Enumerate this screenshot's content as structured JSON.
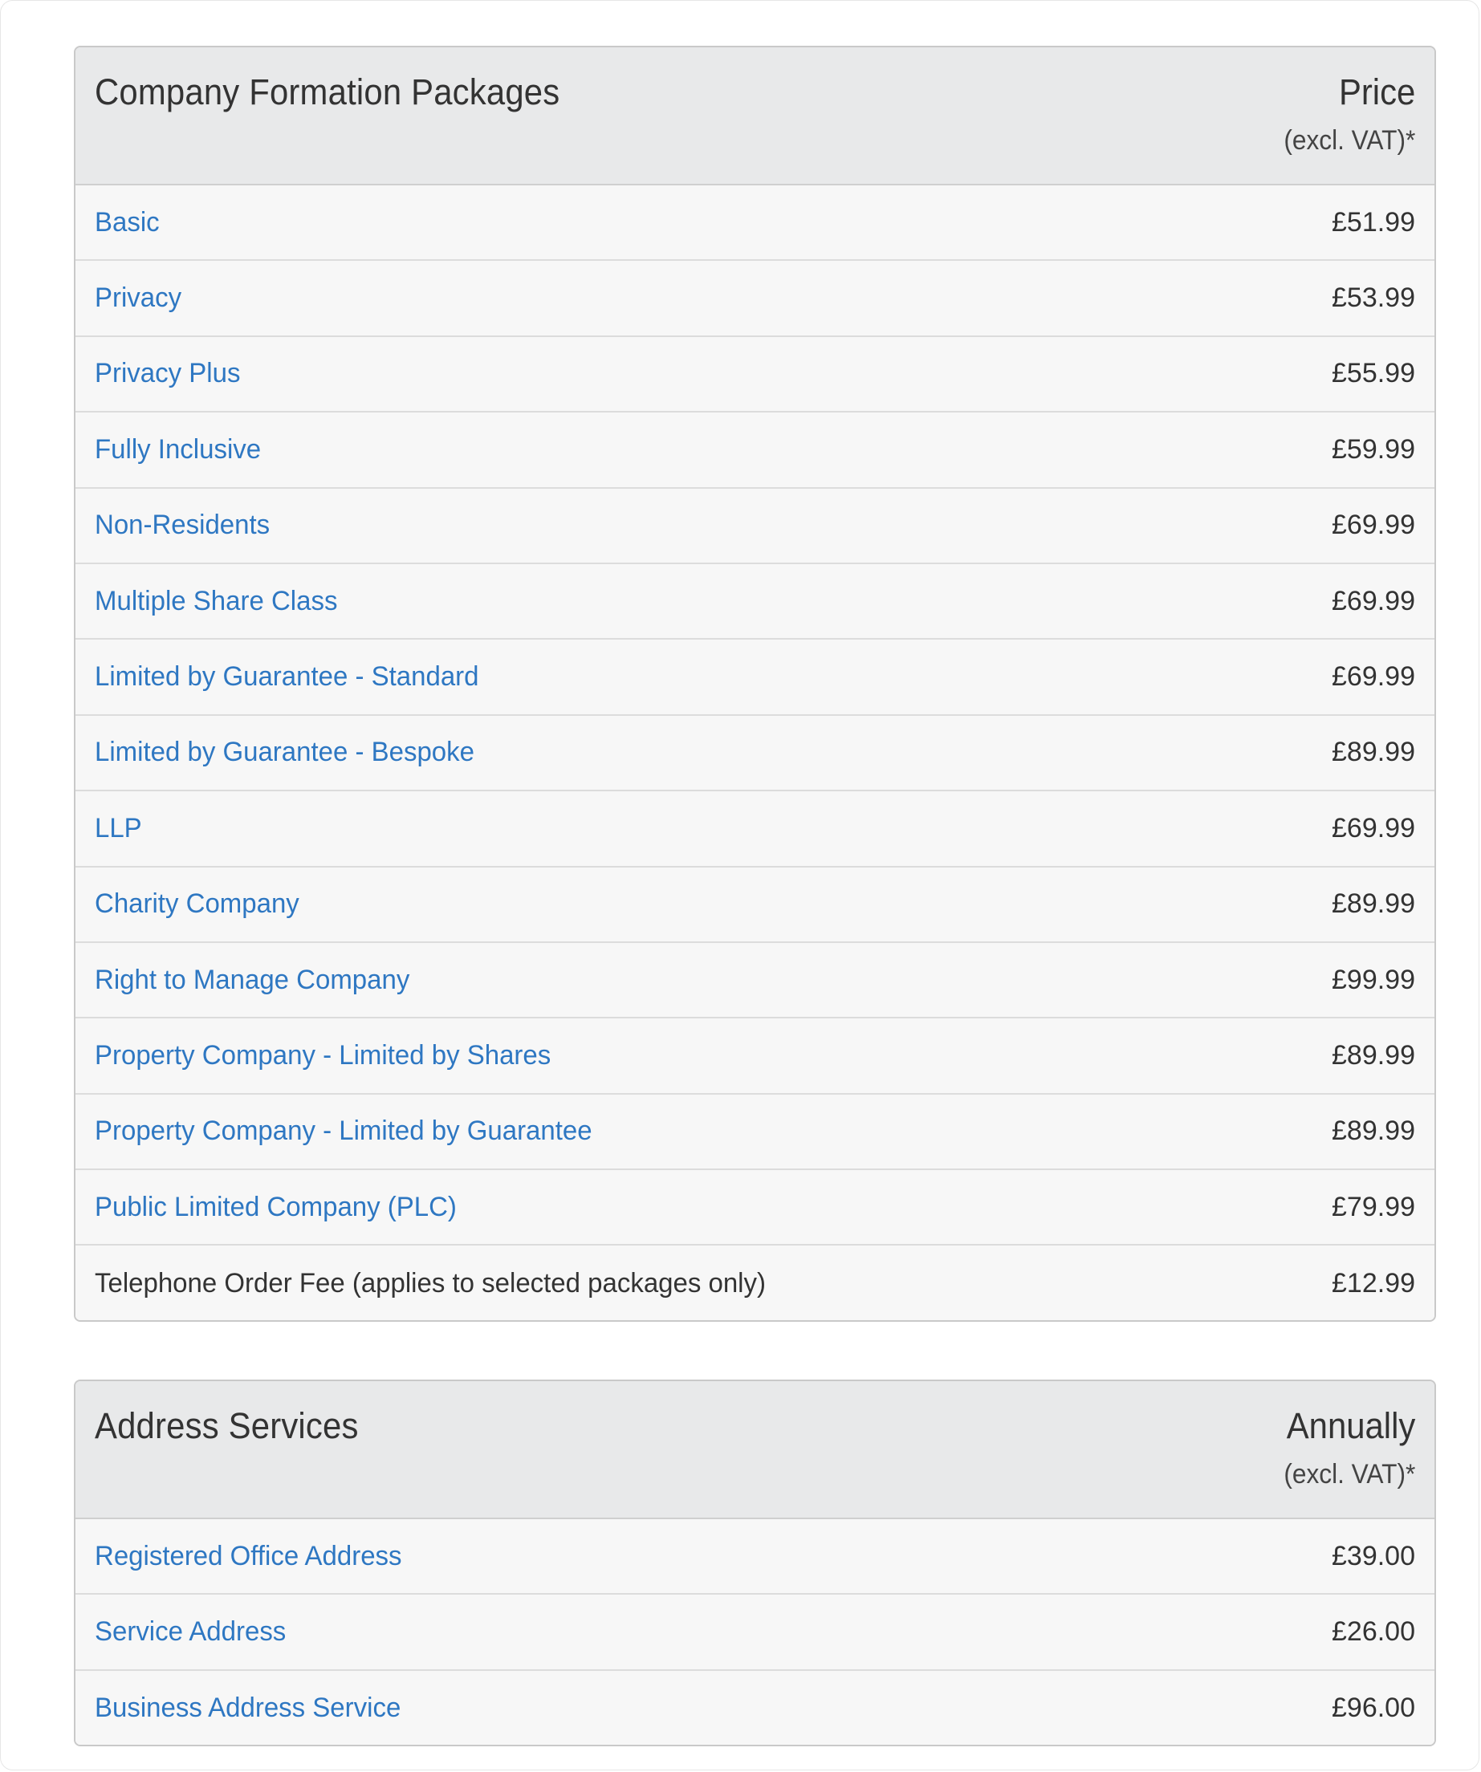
{
  "formation": {
    "title": "Company Formation Packages",
    "column_main": "Price",
    "column_sub": "(excl. VAT)*",
    "rows": [
      {
        "label": "Basic",
        "price": "£51.99",
        "link": true
      },
      {
        "label": "Privacy",
        "price": "£53.99",
        "link": true
      },
      {
        "label": "Privacy Plus",
        "price": "£55.99",
        "link": true
      },
      {
        "label": "Fully Inclusive",
        "price": "£59.99",
        "link": true
      },
      {
        "label": "Non-Residents",
        "price": "£69.99",
        "link": true
      },
      {
        "label": "Multiple Share Class",
        "price": "£69.99",
        "link": true
      },
      {
        "label": "Limited by Guarantee - Standard",
        "price": "£69.99",
        "link": true
      },
      {
        "label": "Limited by Guarantee - Bespoke",
        "price": "£89.99",
        "link": true
      },
      {
        "label": "LLP",
        "price": "£69.99",
        "link": true
      },
      {
        "label": "Charity Company",
        "price": "£89.99",
        "link": true
      },
      {
        "label": "Right to Manage Company",
        "price": "£99.99",
        "link": true
      },
      {
        "label": "Property Company - Limited by Shares",
        "price": "£89.99",
        "link": true
      },
      {
        "label": "Property Company - Limited by Guarantee",
        "price": "£89.99",
        "link": true
      },
      {
        "label": "Public Limited Company (PLC)",
        "price": "£79.99",
        "link": true
      },
      {
        "label": "Telephone Order Fee (applies to selected packages only)",
        "price": "£12.99",
        "link": false
      }
    ]
  },
  "address": {
    "title": "Address Services",
    "column_main": "Annually",
    "column_sub": "(excl. VAT)*",
    "rows": [
      {
        "label": "Registered Office Address",
        "price": "£39.00",
        "link": true
      },
      {
        "label": "Service Address",
        "price": "£26.00",
        "link": true
      },
      {
        "label": "Business Address Service",
        "price": "£96.00",
        "link": true
      }
    ]
  },
  "colors": {
    "link": "#2e77c2",
    "text": "#333333",
    "header_bg": "#e8e9ea",
    "row_bg": "#f7f7f7",
    "border": "#c9c9c9"
  }
}
